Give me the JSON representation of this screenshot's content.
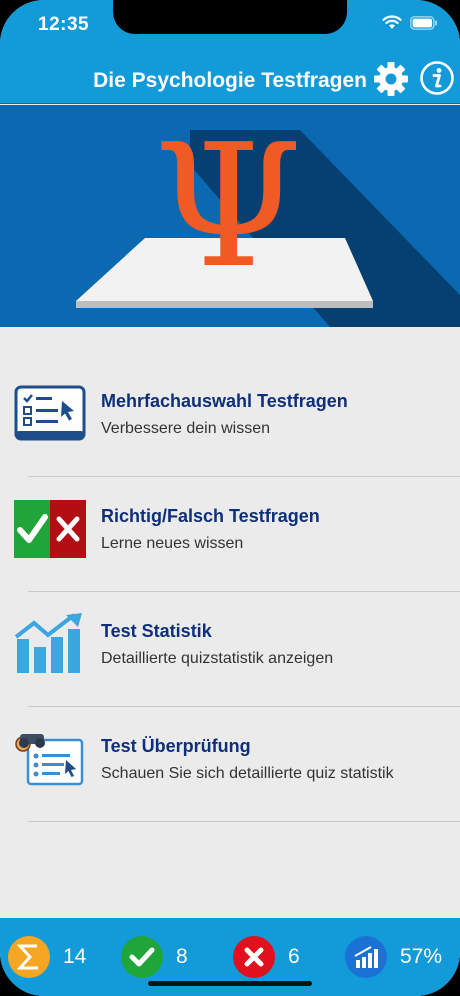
{
  "status": {
    "time": "12:35"
  },
  "navbar": {
    "title": "Die Psychologie Testfragen",
    "settings_icon": "gear-icon",
    "info_icon": "info-icon"
  },
  "banner": {
    "symbol": "Ψ",
    "icon": "psi-symbol-on-paper"
  },
  "menu": [
    {
      "title": "Mehrfachauswahl Testfragen",
      "subtitle": "Verbessere dein wissen",
      "icon": "checklist-icon"
    },
    {
      "title": "Richtig/Falsch Testfragen",
      "subtitle": "Lerne neues wissen",
      "icon": "true-false-icon"
    },
    {
      "title": "Test Statistik",
      "subtitle": "Detaillierte quizstatistik anzeigen",
      "icon": "bar-chart-icon"
    },
    {
      "title": "Test Überprüfung",
      "subtitle": "Schauen Sie sich detaillierte quiz statistik",
      "icon": "review-icon"
    }
  ],
  "footer": {
    "total": "14",
    "correct": "8",
    "wrong": "6",
    "percent": "57%"
  },
  "colors": {
    "primary": "#139ad9",
    "banner": "#0a69b1",
    "title_text": "#0e2f7a",
    "psi": "#f05a24",
    "correct": "#1fa53a",
    "wrong": "#e0101d",
    "sum": "#f5a623"
  }
}
